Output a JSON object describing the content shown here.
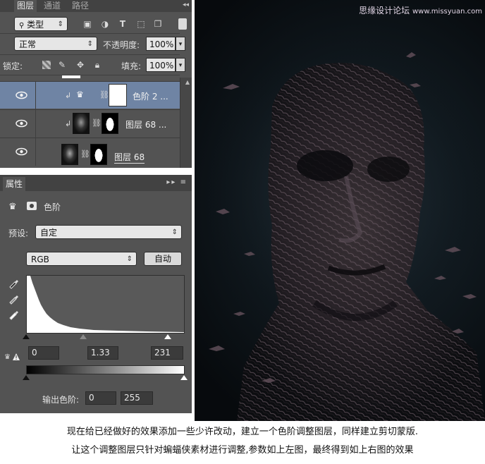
{
  "layers_panel": {
    "tabs": [
      "图层",
      "通道",
      "路径"
    ],
    "filter_kind": "类型",
    "blend_mode": "正常",
    "opacity_label": "不透明度:",
    "opacity_value": "100%",
    "lock_label": "锁定:",
    "fill_label": "填充:",
    "fill_value": "100%",
    "layers": [
      {
        "name": "色阶 2 ...",
        "selected": true
      },
      {
        "name": "图层 68 ...",
        "selected": false
      },
      {
        "name": "图层 68",
        "selected": false
      }
    ]
  },
  "properties_panel": {
    "tab": "属性",
    "title": "色阶",
    "preset_label": "预设:",
    "preset_value": "自定",
    "channel": "RGB",
    "auto_button": "自动",
    "input_black": "0",
    "input_gamma": "1.33",
    "input_white": "231",
    "output_label": "输出色阶:",
    "output_black": "0",
    "output_white": "255"
  },
  "watermark": {
    "main": "思缘设计论坛",
    "sub": "www.missyuan.com"
  },
  "caption": {
    "line1": "现在给已经做好的效果添加一些少许改动，建立一个色阶调整图层，同样建立剪切蒙版.",
    "line2": "让这个调整图层只针对蝙蝠侠素材进行调整,参数如上左图，最终得到如上右图的效果"
  }
}
